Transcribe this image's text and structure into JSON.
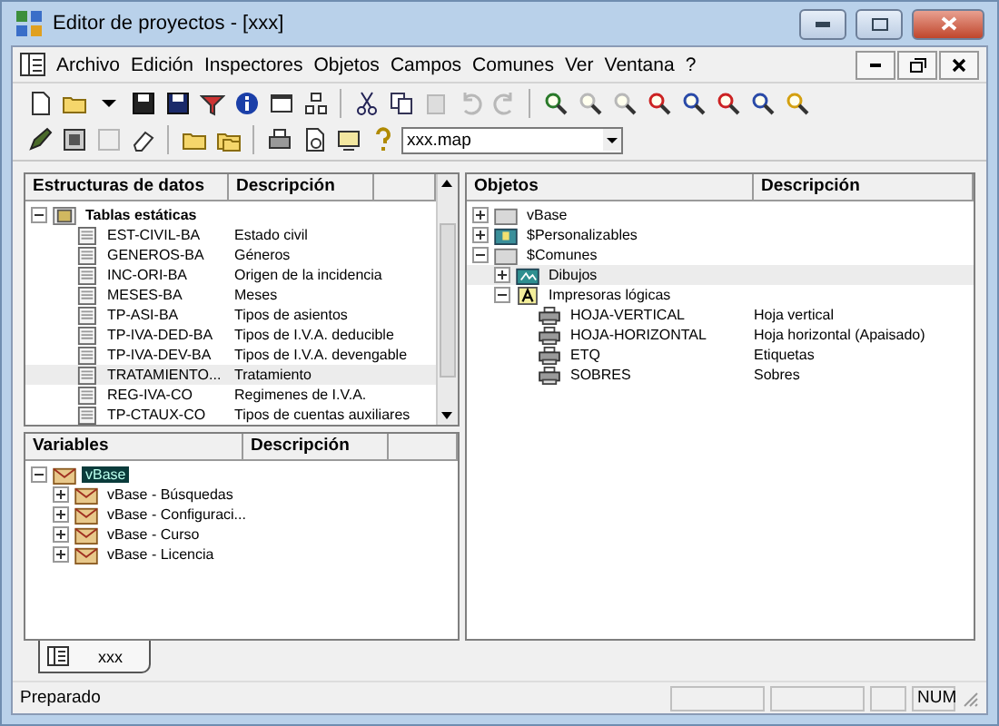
{
  "window": {
    "title": "Editor de proyectos - [xxx]"
  },
  "menu": [
    "Archivo",
    "Edición",
    "Inspectores",
    "Objetos",
    "Campos",
    "Comunes",
    "Ver",
    "Ventana",
    "?"
  ],
  "toolbar": {
    "file_field": {
      "value": "xxx.map"
    }
  },
  "structures": {
    "columns": [
      "Estructuras de datos",
      "Descripción"
    ],
    "tree": [
      {
        "name": "Tablas estáticas",
        "kind": "table-group",
        "expanded": true,
        "selected": false,
        "children": [
          {
            "name": "EST-CIVIL-BA",
            "description": "Estado civil",
            "kind": "table",
            "selected": false
          },
          {
            "name": "GENEROS-BA",
            "description": "Géneros",
            "kind": "table",
            "selected": false
          },
          {
            "name": "INC-ORI-BA",
            "description": "Origen de la incidencia",
            "kind": "table",
            "selected": false
          },
          {
            "name": "MESES-BA",
            "description": "Meses",
            "kind": "table",
            "selected": false
          },
          {
            "name": "TP-ASI-BA",
            "description": "Tipos de asientos",
            "kind": "table",
            "selected": false
          },
          {
            "name": "TP-IVA-DED-BA",
            "description": "Tipos de I.V.A. deducible",
            "kind": "table",
            "selected": false
          },
          {
            "name": "TP-IVA-DEV-BA",
            "description": "Tipos de I.V.A. devengable",
            "kind": "table",
            "selected": false
          },
          {
            "name": "TRATAMIENTO...",
            "description": "Tratamiento",
            "kind": "table",
            "selected": true
          },
          {
            "name": "REG-IVA-CO",
            "description": "Regimenes de I.V.A.",
            "kind": "table",
            "selected": false
          },
          {
            "name": "TP-CTAUX-CO",
            "description": "Tipos de cuentas auxiliares",
            "kind": "table",
            "selected": false
          }
        ]
      }
    ]
  },
  "variables": {
    "columns": [
      "Variables",
      "Descripción"
    ],
    "tree": [
      {
        "name": "vBase",
        "kind": "envelope",
        "expanded": true,
        "selected": true,
        "children": [
          {
            "name": "vBase - Búsquedas",
            "kind": "envelope",
            "expanded": false,
            "selected": false
          },
          {
            "name": "vBase - Configuraci...",
            "kind": "envelope",
            "expanded": false,
            "selected": false
          },
          {
            "name": "vBase - Curso",
            "kind": "envelope",
            "expanded": false,
            "selected": false
          },
          {
            "name": "vBase - Licencia",
            "kind": "envelope",
            "expanded": false,
            "selected": false
          }
        ]
      }
    ]
  },
  "objects": {
    "columns": [
      "Objetos",
      "Descripción"
    ],
    "tree": [
      {
        "name": "vBase",
        "kind": "folder",
        "expanded": false,
        "selected": false
      },
      {
        "name": "$Personalizables",
        "kind": "custom",
        "expanded": false,
        "selected": false
      },
      {
        "name": "$Comunes",
        "kind": "folder",
        "expanded": true,
        "selected": false,
        "children": [
          {
            "name": "Dibujos",
            "kind": "drawings",
            "expanded": false,
            "selected": true
          },
          {
            "name": "Impresoras lógicas",
            "kind": "font",
            "expanded": true,
            "selected": false,
            "children": [
              {
                "name": "HOJA-VERTICAL",
                "description": "Hoja vertical",
                "kind": "printer",
                "selected": false
              },
              {
                "name": "HOJA-HORIZONTAL",
                "description": "Hoja horizontal (Apaisado)",
                "kind": "printer",
                "selected": false
              },
              {
                "name": "ETQ",
                "description": "Etiquetas",
                "kind": "printer",
                "selected": false
              },
              {
                "name": "SOBRES",
                "description": "Sobres",
                "kind": "printer",
                "selected": false
              }
            ]
          }
        ]
      }
    ]
  },
  "document_tabs": [
    {
      "label": "xxx",
      "selected": true
    }
  ],
  "status_bar": {
    "message": "Preparado",
    "panels": [
      "NUM"
    ]
  }
}
